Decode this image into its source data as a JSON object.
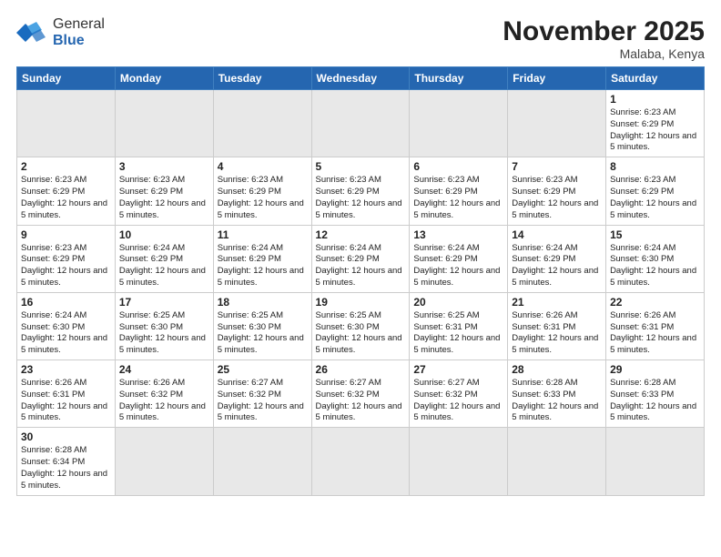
{
  "logo": {
    "text_general": "General",
    "text_blue": "Blue"
  },
  "title": "November 2025",
  "location": "Malaba, Kenya",
  "days_of_week": [
    "Sunday",
    "Monday",
    "Tuesday",
    "Wednesday",
    "Thursday",
    "Friday",
    "Saturday"
  ],
  "weeks": [
    [
      {
        "day": "",
        "info": ""
      },
      {
        "day": "",
        "info": ""
      },
      {
        "day": "",
        "info": ""
      },
      {
        "day": "",
        "info": ""
      },
      {
        "day": "",
        "info": ""
      },
      {
        "day": "",
        "info": ""
      },
      {
        "day": "1",
        "info": "Sunrise: 6:23 AM\nSunset: 6:29 PM\nDaylight: 12 hours and 5 minutes."
      }
    ],
    [
      {
        "day": "2",
        "info": "Sunrise: 6:23 AM\nSunset: 6:29 PM\nDaylight: 12 hours and 5 minutes."
      },
      {
        "day": "3",
        "info": "Sunrise: 6:23 AM\nSunset: 6:29 PM\nDaylight: 12 hours and 5 minutes."
      },
      {
        "day": "4",
        "info": "Sunrise: 6:23 AM\nSunset: 6:29 PM\nDaylight: 12 hours and 5 minutes."
      },
      {
        "day": "5",
        "info": "Sunrise: 6:23 AM\nSunset: 6:29 PM\nDaylight: 12 hours and 5 minutes."
      },
      {
        "day": "6",
        "info": "Sunrise: 6:23 AM\nSunset: 6:29 PM\nDaylight: 12 hours and 5 minutes."
      },
      {
        "day": "7",
        "info": "Sunrise: 6:23 AM\nSunset: 6:29 PM\nDaylight: 12 hours and 5 minutes."
      },
      {
        "day": "8",
        "info": "Sunrise: 6:23 AM\nSunset: 6:29 PM\nDaylight: 12 hours and 5 minutes."
      }
    ],
    [
      {
        "day": "9",
        "info": "Sunrise: 6:23 AM\nSunset: 6:29 PM\nDaylight: 12 hours and 5 minutes."
      },
      {
        "day": "10",
        "info": "Sunrise: 6:24 AM\nSunset: 6:29 PM\nDaylight: 12 hours and 5 minutes."
      },
      {
        "day": "11",
        "info": "Sunrise: 6:24 AM\nSunset: 6:29 PM\nDaylight: 12 hours and 5 minutes."
      },
      {
        "day": "12",
        "info": "Sunrise: 6:24 AM\nSunset: 6:29 PM\nDaylight: 12 hours and 5 minutes."
      },
      {
        "day": "13",
        "info": "Sunrise: 6:24 AM\nSunset: 6:29 PM\nDaylight: 12 hours and 5 minutes."
      },
      {
        "day": "14",
        "info": "Sunrise: 6:24 AM\nSunset: 6:29 PM\nDaylight: 12 hours and 5 minutes."
      },
      {
        "day": "15",
        "info": "Sunrise: 6:24 AM\nSunset: 6:30 PM\nDaylight: 12 hours and 5 minutes."
      }
    ],
    [
      {
        "day": "16",
        "info": "Sunrise: 6:24 AM\nSunset: 6:30 PM\nDaylight: 12 hours and 5 minutes."
      },
      {
        "day": "17",
        "info": "Sunrise: 6:25 AM\nSunset: 6:30 PM\nDaylight: 12 hours and 5 minutes."
      },
      {
        "day": "18",
        "info": "Sunrise: 6:25 AM\nSunset: 6:30 PM\nDaylight: 12 hours and 5 minutes."
      },
      {
        "day": "19",
        "info": "Sunrise: 6:25 AM\nSunset: 6:30 PM\nDaylight: 12 hours and 5 minutes."
      },
      {
        "day": "20",
        "info": "Sunrise: 6:25 AM\nSunset: 6:31 PM\nDaylight: 12 hours and 5 minutes."
      },
      {
        "day": "21",
        "info": "Sunrise: 6:26 AM\nSunset: 6:31 PM\nDaylight: 12 hours and 5 minutes."
      },
      {
        "day": "22",
        "info": "Sunrise: 6:26 AM\nSunset: 6:31 PM\nDaylight: 12 hours and 5 minutes."
      }
    ],
    [
      {
        "day": "23",
        "info": "Sunrise: 6:26 AM\nSunset: 6:31 PM\nDaylight: 12 hours and 5 minutes."
      },
      {
        "day": "24",
        "info": "Sunrise: 6:26 AM\nSunset: 6:32 PM\nDaylight: 12 hours and 5 minutes."
      },
      {
        "day": "25",
        "info": "Sunrise: 6:27 AM\nSunset: 6:32 PM\nDaylight: 12 hours and 5 minutes."
      },
      {
        "day": "26",
        "info": "Sunrise: 6:27 AM\nSunset: 6:32 PM\nDaylight: 12 hours and 5 minutes."
      },
      {
        "day": "27",
        "info": "Sunrise: 6:27 AM\nSunset: 6:32 PM\nDaylight: 12 hours and 5 minutes."
      },
      {
        "day": "28",
        "info": "Sunrise: 6:28 AM\nSunset: 6:33 PM\nDaylight: 12 hours and 5 minutes."
      },
      {
        "day": "29",
        "info": "Sunrise: 6:28 AM\nSunset: 6:33 PM\nDaylight: 12 hours and 5 minutes."
      }
    ],
    [
      {
        "day": "30",
        "info": "Sunrise: 6:28 AM\nSunset: 6:34 PM\nDaylight: 12 hours and 5 minutes."
      },
      {
        "day": "",
        "info": ""
      },
      {
        "day": "",
        "info": ""
      },
      {
        "day": "",
        "info": ""
      },
      {
        "day": "",
        "info": ""
      },
      {
        "day": "",
        "info": ""
      },
      {
        "day": "",
        "info": ""
      }
    ]
  ]
}
